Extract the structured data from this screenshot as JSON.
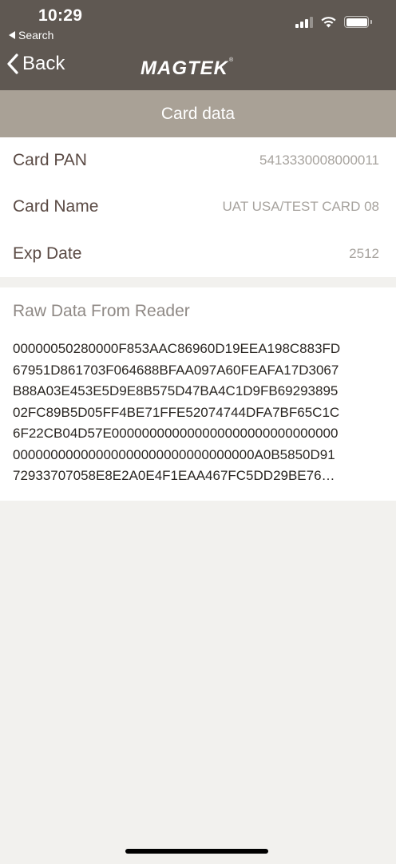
{
  "status_bar": {
    "time": "10:29",
    "back_app_label": "Search",
    "icons": [
      "cellular-signal-icon",
      "wifi-icon",
      "battery-icon"
    ]
  },
  "nav": {
    "back_label": "Back",
    "logo_text": "MAGTEK",
    "logo_mark": "®"
  },
  "header": {
    "title": "Card data"
  },
  "card": {
    "rows": [
      {
        "label": "Card PAN",
        "value": "5413330008000011"
      },
      {
        "label": "Card Name",
        "value": "UAT USA/TEST CARD 08"
      },
      {
        "label": "Exp Date",
        "value": "2512"
      }
    ]
  },
  "raw": {
    "title": "Raw Data From Reader",
    "lines": [
      "00000050280000F853AAC86960D19EEA198C883FD",
      "67951D861703F064688BFAA097A60FEAFA17D3067",
      "B88A03E453E5D9E8B575D47BA4C1D9FB69293895",
      "02FC89B5D05FF4BE71FFE52074744DFA7BF65C1C",
      "6F22CB04D57E000000000000000000000000000000",
      "00000000000000000000000000000000A0B5850D91",
      "72933707058E8E2A0E4F1EAA467FC5DD29BE76…"
    ]
  },
  "colors": {
    "nav_bg": "#5F5852",
    "section_bg": "#A9A196",
    "page_bg": "#F2F1EE",
    "label_color": "#5A4A44",
    "value_color": "#A7A39E"
  }
}
